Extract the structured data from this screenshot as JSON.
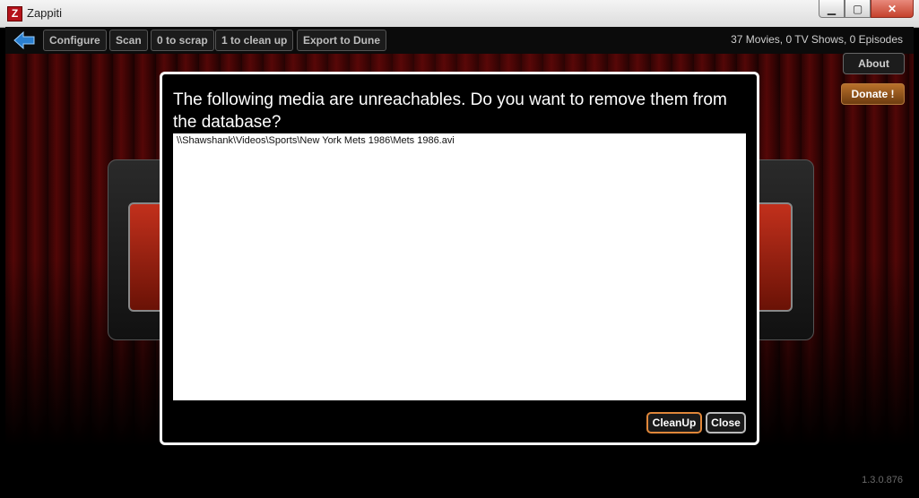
{
  "window": {
    "title": "Zappiti",
    "icon_letter": "Z",
    "controls": {
      "minimize": "▁",
      "maximize": "▢",
      "close": "✕"
    }
  },
  "toolbar": {
    "back_icon": "back-arrow-icon",
    "buttons": [
      "Configure",
      "Scan",
      "0 to scrap",
      "1 to clean up",
      "Export to Dune"
    ],
    "counts": "37 Movies, 0 TV Shows, 0 Episodes"
  },
  "side": {
    "about": "About",
    "donate": "Donate !"
  },
  "dialog": {
    "title": "The following media are unreachables. Do you want to remove them from the database?",
    "items": [
      "\\\\Shawshank\\Videos\\Sports\\New York Mets 1986\\Mets 1986.avi"
    ],
    "cleanup": "CleanUp",
    "close": "Close"
  },
  "version": "1.3.0.876",
  "colors": {
    "accent": "#e0873a",
    "curtain": "#520707",
    "close_button": "#c5412c"
  }
}
